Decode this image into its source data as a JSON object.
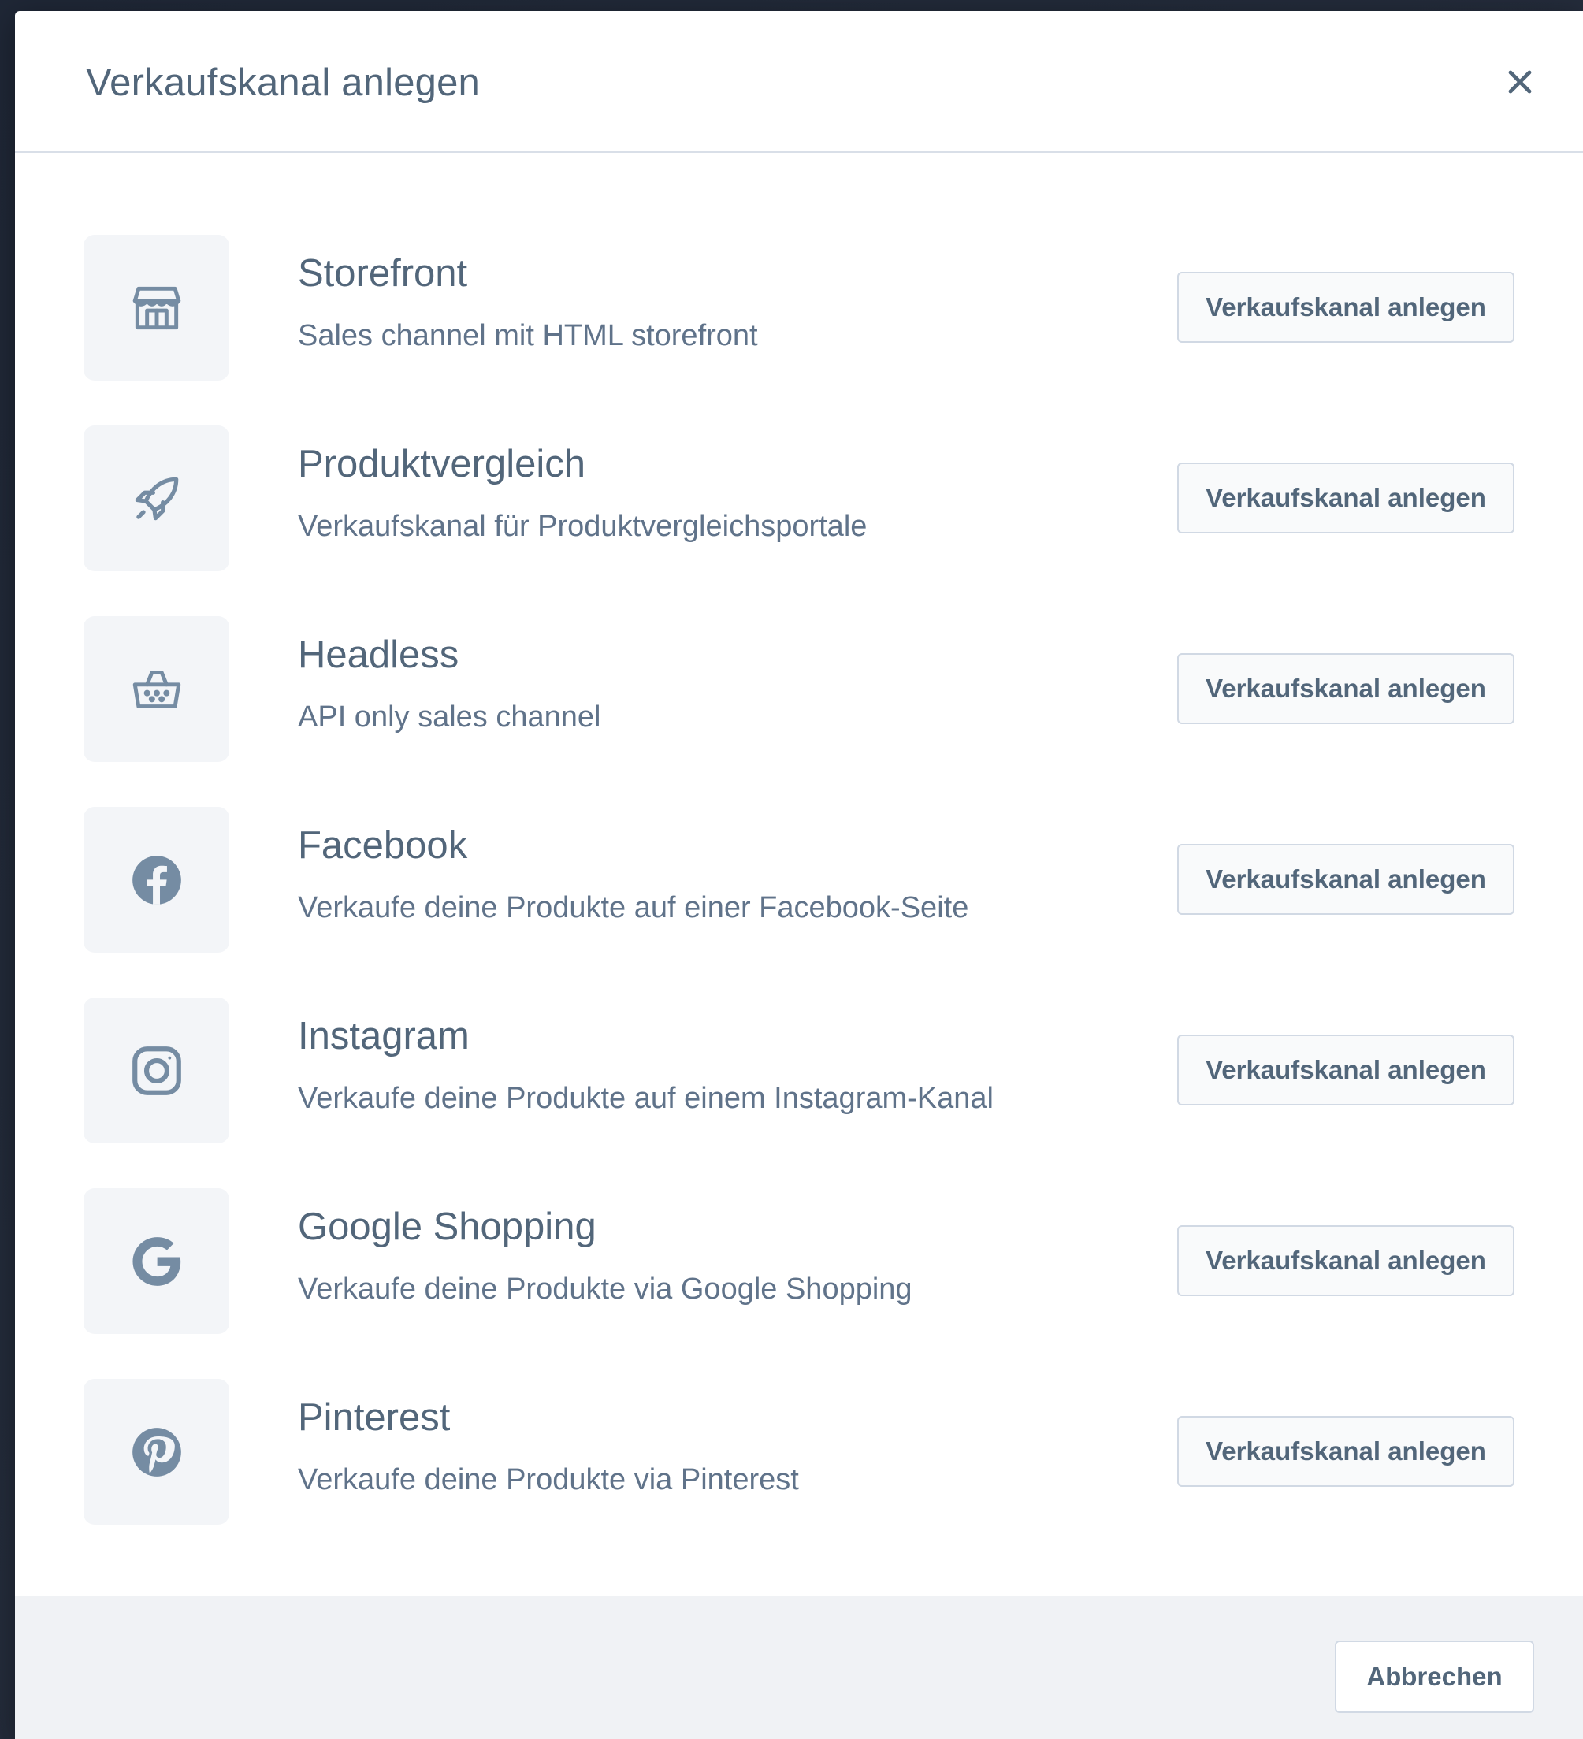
{
  "modal": {
    "title": "Verkaufskanal anlegen"
  },
  "channels": [
    {
      "name": "Storefront",
      "description": "Sales channel mit HTML storefront",
      "button_label": "Verkaufskanal anlegen",
      "icon": "storefront-icon"
    },
    {
      "name": "Produktvergleich",
      "description": "Verkaufskanal für Produktvergleichsportale",
      "button_label": "Verkaufskanal anlegen",
      "icon": "rocket-icon"
    },
    {
      "name": "Headless",
      "description": "API only sales channel",
      "button_label": "Verkaufskanal anlegen",
      "icon": "basket-icon"
    },
    {
      "name": "Facebook",
      "description": "Verkaufe deine Produkte auf einer Facebook-Seite",
      "button_label": "Verkaufskanal anlegen",
      "icon": "facebook-icon"
    },
    {
      "name": "Instagram",
      "description": "Verkaufe deine Produkte auf einem Instagram-Kanal",
      "button_label": "Verkaufskanal anlegen",
      "icon": "instagram-icon"
    },
    {
      "name": "Google Shopping",
      "description": "Verkaufe deine Produkte via Google Shopping",
      "button_label": "Verkaufskanal anlegen",
      "icon": "google-icon"
    },
    {
      "name": "Pinterest",
      "description": "Verkaufe deine Produkte via Pinterest",
      "button_label": "Verkaufskanal anlegen",
      "icon": "pinterest-icon"
    }
  ],
  "footer": {
    "cancel_label": "Abbrechen"
  },
  "colors": {
    "text": "#52667a",
    "icon": "#758ca3",
    "border": "#d1d9e4",
    "footer_bg": "#f0f2f5"
  }
}
